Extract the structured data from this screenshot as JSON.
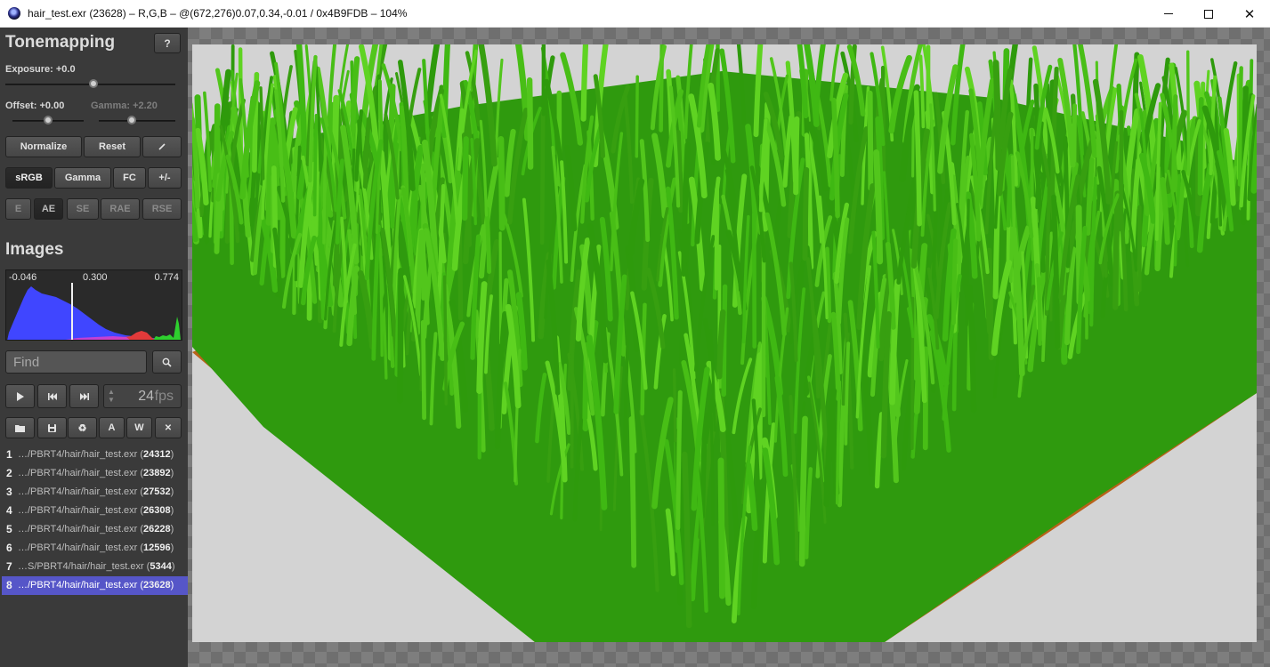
{
  "window": {
    "title": "hair_test.exr (23628) – R,G,B – @(672,276)0.07,0.34,-0.01 / 0x4B9FDB – 104%"
  },
  "tonemapping": {
    "title": "Tonemapping",
    "help_label": "?",
    "exposure_label": "Exposure: +0.0",
    "offset_label": "Offset: +0.00",
    "gamma_label": "Gamma: +2.20",
    "exposure_value": 0.0,
    "offset_value": 0.0,
    "gamma_value": 2.2,
    "normalize_label": "Normalize",
    "reset_label": "Reset",
    "colormaps": [
      {
        "label": "sRGB",
        "active": true
      },
      {
        "label": "Gamma",
        "active": false
      },
      {
        "label": "FC",
        "active": false
      },
      {
        "label": "+/-",
        "active": false
      }
    ],
    "error_metrics": [
      {
        "label": "E",
        "active": false
      },
      {
        "label": "AE",
        "active": true
      },
      {
        "label": "SE",
        "active": false
      },
      {
        "label": "RAE",
        "active": false
      },
      {
        "label": "RSE",
        "active": false
      }
    ]
  },
  "images": {
    "title": "Images",
    "histogram": {
      "min_label": "-0.046",
      "mid_label": "0.300",
      "max_label": "0.774"
    },
    "find_placeholder": "Find",
    "fps_value": "24",
    "fps_unit": "fps",
    "action_a": "A",
    "action_w": "W",
    "list": [
      {
        "num": "1",
        "path": "…/PBRT4/hair/hair_test.exr (",
        "id": "24312",
        "close": ")",
        "selected": false
      },
      {
        "num": "2",
        "path": "…/PBRT4/hair/hair_test.exr (",
        "id": "23892",
        "close": ")",
        "selected": false
      },
      {
        "num": "3",
        "path": "…/PBRT4/hair/hair_test.exr (",
        "id": "27532",
        "close": ")",
        "selected": false
      },
      {
        "num": "4",
        "path": "…/PBRT4/hair/hair_test.exr (",
        "id": "26308",
        "close": ")",
        "selected": false
      },
      {
        "num": "5",
        "path": "…/PBRT4/hair/hair_test.exr (",
        "id": "26228",
        "close": ")",
        "selected": false
      },
      {
        "num": "6",
        "path": "…/PBRT4/hair/hair_test.exr (",
        "id": "12596",
        "close": ")",
        "selected": false
      },
      {
        "num": "7",
        "path": "…S/PBRT4/hair/hair_test.exr (",
        "id": "5344",
        "close": ")",
        "selected": false
      },
      {
        "num": "8",
        "path": "…/PBRT4/hair/hair_test.exr (",
        "id": "23628",
        "close": ")",
        "selected": true
      }
    ]
  },
  "colors": {
    "sidebar_bg": "#3a3a3a",
    "selection": "#5656c8",
    "canvas_bg": "#d3d3d3",
    "ground": "#c26a1c",
    "grass": "#3fae12"
  }
}
